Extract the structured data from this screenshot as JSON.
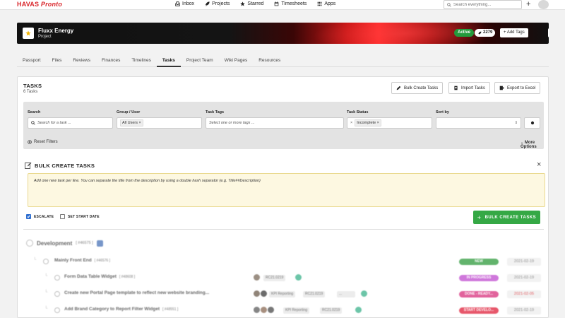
{
  "brand": {
    "havas": "HAVAS",
    "pronto": "Pronto"
  },
  "nav": [
    {
      "label": "Inbox",
      "icon": "inbox-icon"
    },
    {
      "label": "Projects",
      "icon": "rocket-icon"
    },
    {
      "label": "Starred",
      "icon": "star-icon"
    },
    {
      "label": "Timesheets",
      "icon": "calendar-icon"
    },
    {
      "label": "Apps",
      "icon": "grid-icon"
    }
  ],
  "search": {
    "placeholder": "Search everything..."
  },
  "project": {
    "name": "Fluxx Energy",
    "type": "Project",
    "status": "Active",
    "count": "2279",
    "add_tags": "+ Add Tags",
    "menu": "⋮"
  },
  "tabs": [
    "Passport",
    "Files",
    "Reviews",
    "Finances",
    "Timelines",
    "Tasks",
    "Project Team",
    "Wiki Pages",
    "Resources"
  ],
  "active_tab": "Tasks",
  "tasks_card": {
    "title": "TASKS",
    "count": "6 Tasks",
    "bulk_btn": "Bulk Create Tasks",
    "import_btn": "Import Tasks",
    "export_btn": "Export to Excel"
  },
  "filters": {
    "search_label": "Search",
    "search_placeholder": "Search for a task ...",
    "group_label": "Group / User",
    "group_chip": "All Users",
    "tags_label": "Task Tags",
    "tags_placeholder": "Select one or more tags ...",
    "status_label": "Task Status",
    "status_chip": "Incomplete",
    "sort_label": "Sort by",
    "reset": "Reset Filters",
    "more": "More Options"
  },
  "bulk": {
    "title": "BULK CREATE TASKS",
    "hint": "Add one new task per line. You can separate the title from the description by using a double hash separator (e.g. Title##Description)",
    "escalate": "ESCALATE",
    "set_start": "SET START DATE",
    "button": "BULK CREATE TASKS"
  },
  "group": {
    "name": "Development",
    "id": "[ #46575 ]"
  },
  "rows": [
    {
      "name": "Mainly Front End",
      "id": "[ #46576 ]",
      "status": "NEW",
      "status_color": "#2e9a3c",
      "date": "2021-02-19"
    },
    {
      "name": "Form Data Table Widget",
      "id": "[ #48608 ]",
      "tags": [
        "RC21.0219"
      ],
      "status": "IN PROGRESS",
      "status_color": "#c04ad0",
      "date": "2021-02-19"
    },
    {
      "name": "Create new Portal Page template to reflect new website branding...",
      "id": "",
      "tags": [
        "KPI Reporting",
        "RC21.0219",
        "..."
      ],
      "status": "DONE - READY...",
      "status_color": "#d82f7c",
      "date": "2021-02-05"
    },
    {
      "name": "Add Brand Category to Report Filter Widget",
      "id": "[ #48551 ]",
      "tags": [
        "KPI Reporting",
        "RC21.0219"
      ],
      "status": "START DEVELO...",
      "status_color": "#e0203a",
      "date": "2021-02-19"
    }
  ],
  "colors": {
    "accent": "#d9262b",
    "success": "#35a845",
    "active_badge": "#239b3c"
  }
}
